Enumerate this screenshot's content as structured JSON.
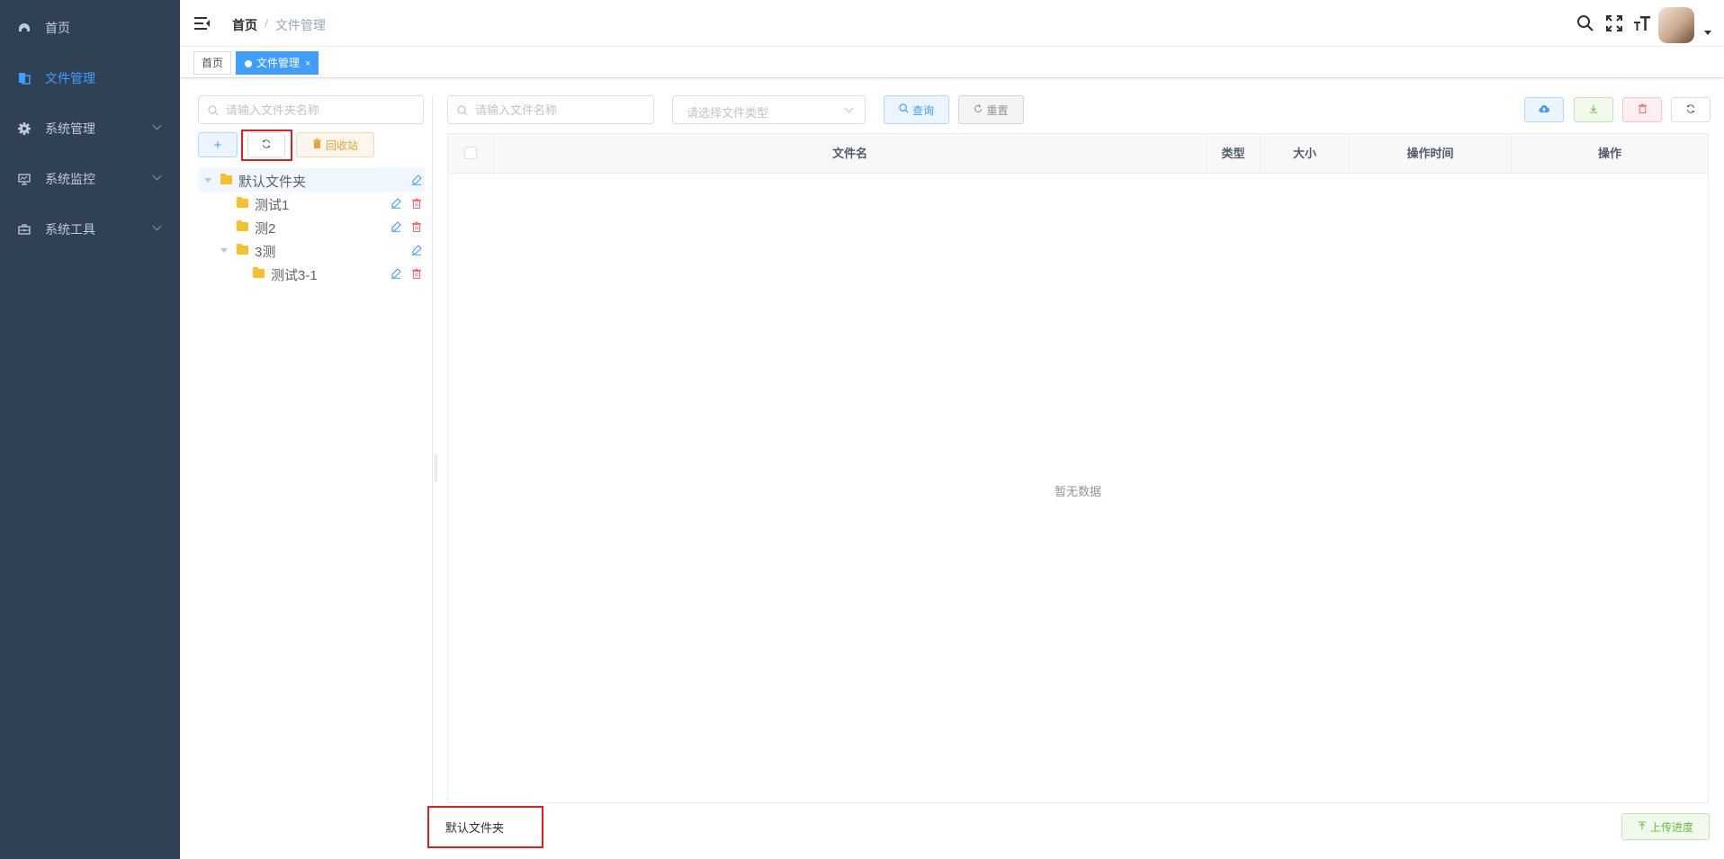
{
  "sidebar": {
    "items": [
      {
        "label": "首页",
        "icon": "dashboard-icon",
        "active": false,
        "has_children": false
      },
      {
        "label": "文件管理",
        "icon": "file-icon",
        "active": true,
        "has_children": false
      },
      {
        "label": "系统管理",
        "icon": "gear-icon",
        "active": false,
        "has_children": true
      },
      {
        "label": "系统监控",
        "icon": "monitor-icon",
        "active": false,
        "has_children": true
      },
      {
        "label": "系统工具",
        "icon": "toolbox-icon",
        "active": false,
        "has_children": true
      }
    ]
  },
  "navbar": {
    "breadcrumb": {
      "home": "首页",
      "separator": "/",
      "current": "文件管理"
    },
    "icons": [
      "search-icon",
      "fullscreen-icon",
      "font-size-icon"
    ]
  },
  "tags": [
    {
      "label": "首页",
      "active": false
    },
    {
      "label": "文件管理",
      "active": true,
      "close": "×"
    }
  ],
  "folder_panel": {
    "search_placeholder": "请输入文件夹名称",
    "add_label": "+",
    "recycle_label": "回收站",
    "tree": [
      {
        "label": "默认文件夹",
        "level": 0,
        "expanded": true,
        "editable": true,
        "deletable": false,
        "current": true
      },
      {
        "label": "测试1",
        "level": 1,
        "expanded": false,
        "editable": true,
        "deletable": true
      },
      {
        "label": "测2",
        "level": 1,
        "expanded": false,
        "editable": true,
        "deletable": true
      },
      {
        "label": "3测",
        "level": 1,
        "expanded": true,
        "editable": true,
        "deletable": false
      },
      {
        "label": "测试3-1",
        "level": 2,
        "expanded": false,
        "editable": true,
        "deletable": true
      }
    ]
  },
  "file_panel": {
    "search_placeholder": "请输入文件名称",
    "type_placeholder": "请选择文件类型",
    "query_label": "查询",
    "reset_label": "重置",
    "columns": [
      "文件名",
      "类型",
      "大小",
      "操作时间",
      "操作"
    ],
    "empty_text": "暂无数据",
    "upload_progress_label": "上传进度"
  },
  "current_path": "默认文件夹",
  "colors": {
    "sidebar_bg": "#304156",
    "primary": "#409eff",
    "warning": "#e6a23c",
    "success": "#67c23a",
    "danger": "#f56c6c"
  }
}
